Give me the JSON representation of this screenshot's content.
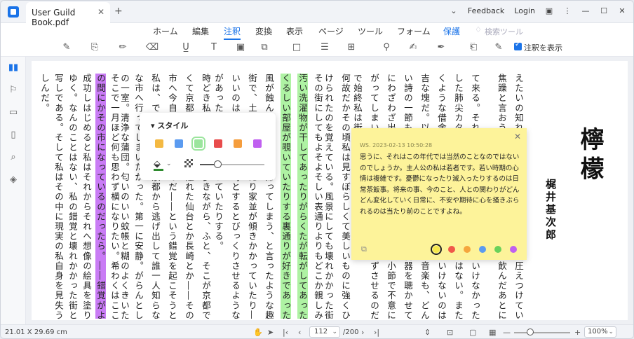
{
  "titlebar": {
    "tab_title": "User Guild Book.pdf",
    "feedback": "Feedback",
    "login": "Login"
  },
  "menu": [
    "ホーム",
    "編集",
    "注釈",
    "変換",
    "表示",
    "ページ",
    "ツール",
    "フォーム",
    "保護",
    "検索ツール"
  ],
  "toolbar": {
    "show_annotations_label": "注釈を表示"
  },
  "book": {
    "title": "檸檬",
    "author": "梶井基次郎",
    "columns": [
      "えたいの知れない不吉な塊が私の心を始終圧えつけていた。",
      "焦躁と言おうか、嫌悪と言おうか――酒を飲んだあとに宿酔があるように、",
      "て来る。それが来たのだ。これはちょっといけなかった。結果",
      "した肺尖カタルや神経衰弱がいけないのではない。また背を焼",
      "くような借金などがいけないのではない。いけないのはその不",
      "吉な塊だ。以前私を喜ばせたどんな美しい音楽も、どんな美し",
      "い詩の一節も辛抱がならなくなった。蓄音器を聴かせてもらい",
      "にわざわざ出かけて行っても、最初の二三小節で不意に立ち上",
      "がってしまいたくなる。何かが私を居堪らずさせるのだ。それ",
      "で始終私は街から街を浮浪し続けていた。",
      "何故だかその頃私は見すぼらしくて美しいものに強くひきつ",
      "けられたのを覚えている。風景にしても壊れかかった街だとか、",
      "その街にしてもよそよそしい表通りよりもどこか親しみのある、",
      "汚い洗濯物が干してあったりがらくたが転がしてあったりむさ",
      "くるしい部屋が覗いていたりする裏通りが好きであった。雨や",
      "風が蝕んでやがて土に帰ってしまう、と言ったような趣きのある",
      "街で、土塀が崩れていたり家並が傾きかかっていたり――勢いの",
      "いいのは植物だけで、時とするとびっくりさせるような向日葵",
      "があったりカンナが咲いていたりする。",
      "時どき私はそんな路を歩きながら、ふと、そこが京都ではな",
      "くて京都から何百里も離れた仙台とか長崎とか――そのような",
      "市へ今自分が来ているのだ――という錯覚を起こそうと努める。",
      "私は、できることなら京都から逃げ出して誰一人知らないよう",
      "な市へ行ってしまいたかった。第一に安静。がらんとした旅館",
      "の一室。清浄な蒲団。匂いのいい蚊帳と糊のよくきいた浴衣。",
      "そこで一月ほど何も思わず横になりたい。希わくはここがいつ",
      "の間にかその市になっているのだったら。――錯覚がようやく",
      "成功しはじめると私はそれからそれへ想像の絵具を塗りつけて",
      "ゆく。なんのことはない、私の錯覚と壊れかかった街との二重",
      "写しである。そして私はその中に現実の私自身を見失うのを楽",
      "しんだ。"
    ]
  },
  "style_popup": {
    "header": "スタイル",
    "swatches": [
      "#f4b942",
      "#5b9bf0",
      "#9be59d",
      "#e84c4c",
      "#f59d3d",
      "#c060f0"
    ]
  },
  "note": {
    "meta": "WS. 2023-02-13 10:50:28",
    "body": "思うに、それはこの年代では当然のことなのではないのでしょうか。主人公の私は若者です。若い時期の心情は複雑です。憂鬱になったり滅入ったりするのは日常茶飯事。将来の事、今のこと、人との関わりがどんどん変化していく日常に、不安や期待に心を掻きぶられるのは当たり前のことですよね。",
    "colors": [
      "#f6e84a",
      "#f0584a",
      "#f5a63d",
      "#5b9bf0",
      "#6ad15a",
      "#c060f0"
    ]
  },
  "statusbar": {
    "page_size": "21.01 X 29.69 cm",
    "page_current": "112",
    "page_total": "/200",
    "zoom": "100%"
  }
}
